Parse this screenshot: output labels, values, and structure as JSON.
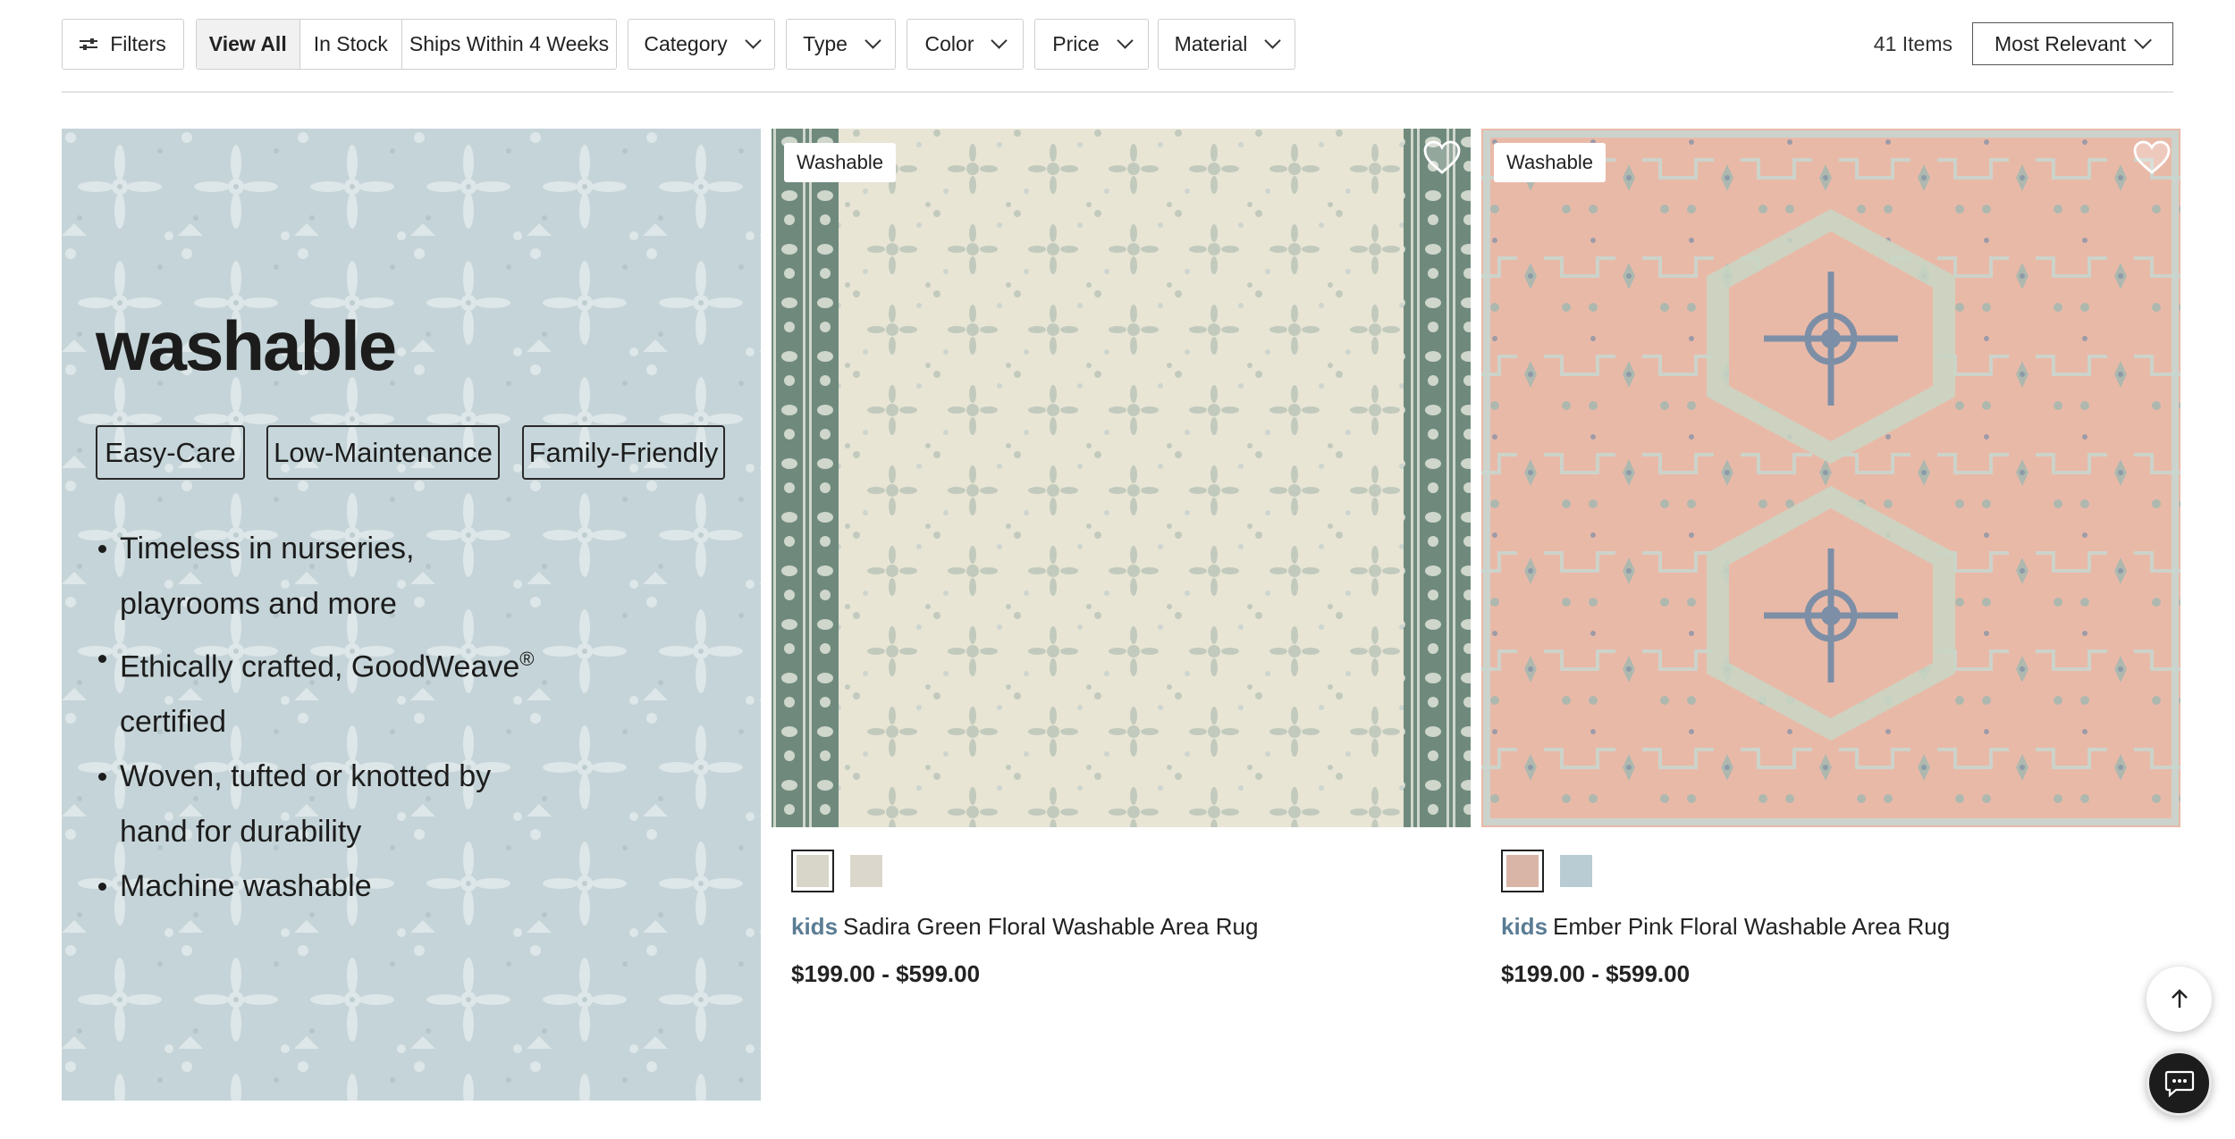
{
  "toolbar": {
    "filters_label": "Filters",
    "quick_filters": [
      "View All",
      "In Stock",
      "Ships Within 4 Weeks"
    ],
    "active_quick_filter": "View All",
    "dropdowns": [
      "Category",
      "Type",
      "Color",
      "Price",
      "Material"
    ],
    "items_count": "41 Items",
    "sort_label": "Most Relevant"
  },
  "promo": {
    "title": "washable",
    "chips": [
      "Easy-Care",
      "Low-Maintenance",
      "Family-Friendly"
    ],
    "bullets": {
      "b1": "Timeless in nurseries,",
      "b1b": "playrooms and more",
      "b2": "Ethically crafted, GoodWeave",
      "b2_mark": "®",
      "b2b": "certified",
      "b3": "Woven, tufted or knotted by",
      "b3b": "hand for durability",
      "b4": "Machine washable"
    },
    "colors": {
      "base": "#c4d3d7",
      "pattern": "#eef2f1"
    }
  },
  "products": [
    {
      "badge": "Washable",
      "brand": "kids",
      "name": "Sadira Green Floral Washable Area Rug",
      "price": "$199.00 - $599.00",
      "colors": {
        "field": "#e6e3d3",
        "border": "#6f8a7d",
        "motif": "#8fa69a"
      },
      "swatches": [
        "#d7d6c8",
        "#dcd7cc"
      ]
    },
    {
      "badge": "Washable",
      "brand": "kids",
      "name": "Ember Pink Floral Washable Area Rug",
      "price": "$199.00 - $599.00",
      "colors": {
        "field": "#e9b9a8",
        "border": "#9fb8b0",
        "motif": "#7d8fa6"
      },
      "swatches": [
        "#d9b5a7",
        "#b9cbd3"
      ]
    }
  ],
  "icons": {
    "filters": "sliders-icon",
    "heart": "heart-outline-icon",
    "back_to_top": "arrow-up-icon",
    "chat": "chat-bubble-icon"
  }
}
